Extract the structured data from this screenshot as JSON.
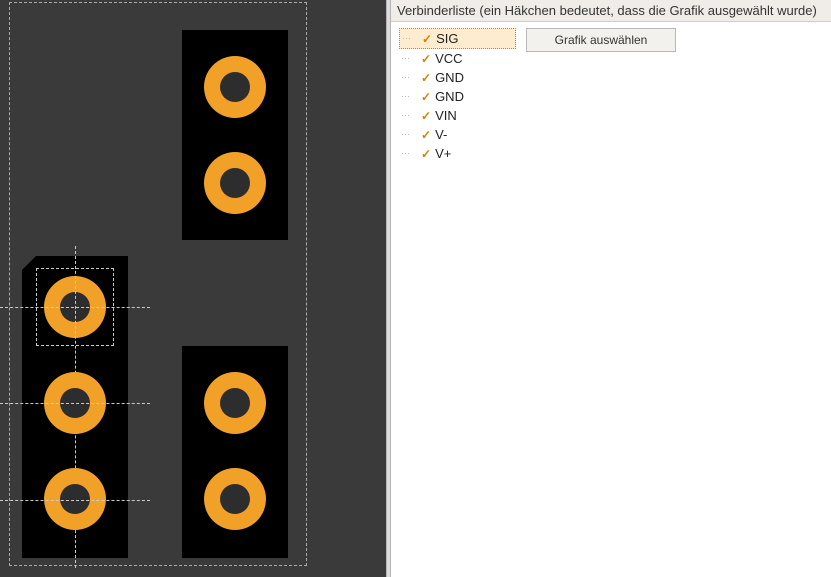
{
  "panel": {
    "header": "Verbinderliste (ein Häkchen bedeutet, dass die Grafik ausgewählt wurde)",
    "button_label": "Grafik auswählen"
  },
  "connectors": [
    {
      "name": "SIG",
      "checked": true,
      "selected": true
    },
    {
      "name": "VCC",
      "checked": true,
      "selected": false
    },
    {
      "name": "GND",
      "checked": true,
      "selected": false
    },
    {
      "name": "GND",
      "checked": true,
      "selected": false
    },
    {
      "name": "VIN",
      "checked": true,
      "selected": false
    },
    {
      "name": "V-",
      "checked": true,
      "selected": false
    },
    {
      "name": "V+",
      "checked": true,
      "selected": false
    }
  ]
}
